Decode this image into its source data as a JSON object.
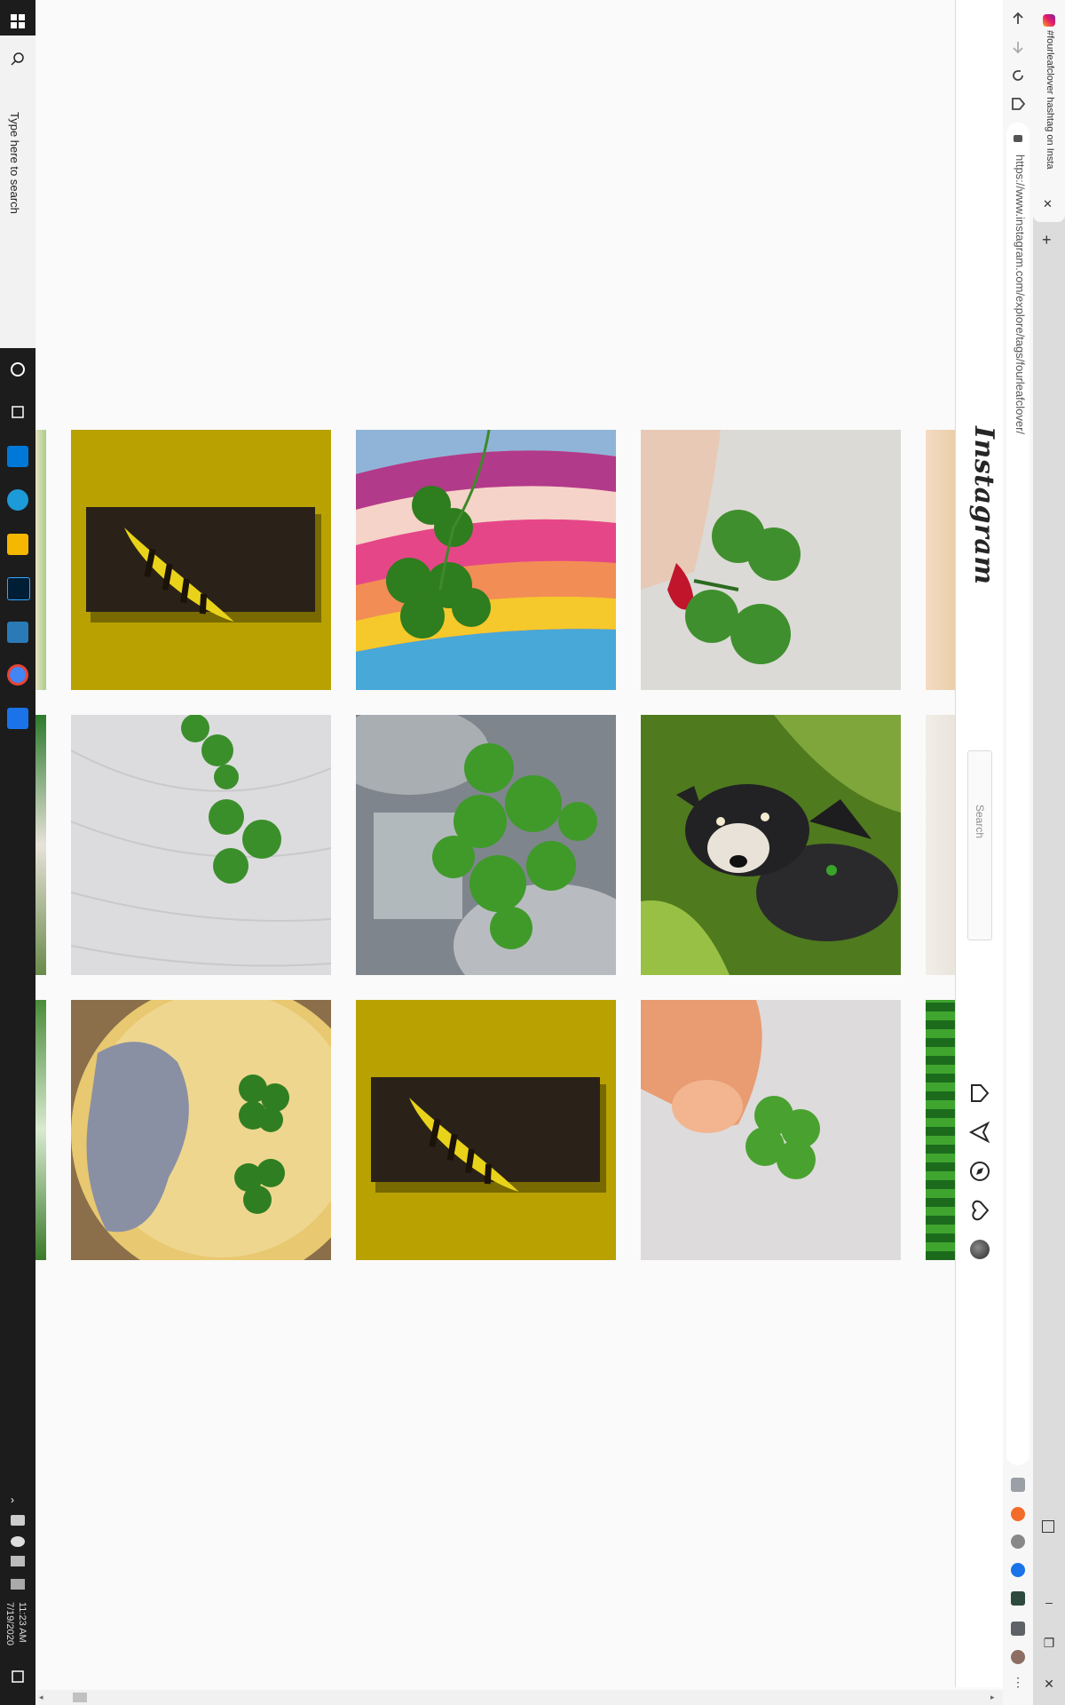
{
  "taskbar": {
    "search_placeholder": "Type here to search",
    "time": "11:23 AM",
    "date": "7/19/2020"
  },
  "browser": {
    "tab_title": "#fourleafclover hashtag on Insta",
    "url": "https://www.instagram.com/explore/tags/fourleafclover/",
    "accent": "#1a73e8"
  },
  "instagram": {
    "logo": "Instagram",
    "search_placeholder": "Search"
  },
  "posts": [
    {
      "id": "post-feather-leaf-1",
      "desc": "yellow-striped leaf on soil, mustard background"
    },
    {
      "id": "post-clover-on-stripes",
      "desc": "four leaf clovers on striped leather"
    },
    {
      "id": "post-clover-in-hand",
      "desc": "hand holding four leaf clover"
    },
    {
      "id": "post-clovers-on-wood",
      "desc": "clover leaves on white wood"
    },
    {
      "id": "post-clover-bouquet",
      "desc": "clover bouquet in glass vase"
    },
    {
      "id": "post-dog-in-grass",
      "desc": "dog lying in grass with clover"
    },
    {
      "id": "post-grapefruit-clover",
      "desc": "clovers on grapefruit with lichen"
    },
    {
      "id": "post-feather-leaf-2",
      "desc": "yellow-striped leaf on soil, mustard background"
    },
    {
      "id": "post-clover-fingers",
      "desc": "fingers holding small clover"
    }
  ]
}
